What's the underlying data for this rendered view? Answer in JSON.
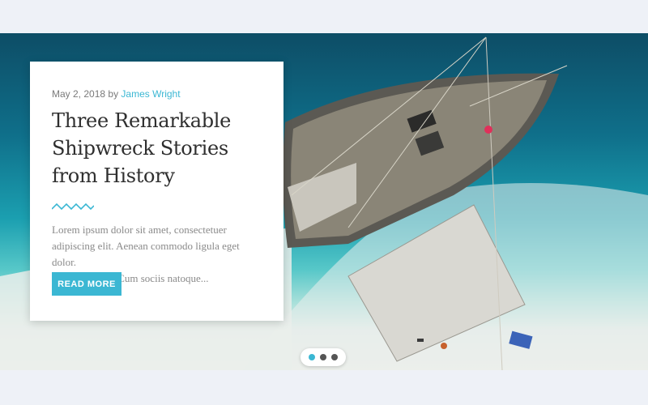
{
  "post": {
    "date": "May 2, 2018",
    "by": "by",
    "author": "James Wright",
    "title_line1": "Three Remarkable",
    "title_line2": "Shipwreck Stories",
    "title_line3": "from History",
    "excerpt_line1": "Lorem ipsum dolor sit amet, consectetuer",
    "excerpt_line2": "adipiscing elit. Aenean commodo ligula eget dolor.",
    "excerpt_line3": "Aenean massa. Cum sociis natoque...",
    "button_label": "READ MORE"
  },
  "slider": {
    "active_index": 0,
    "dot_count": 3
  },
  "colors": {
    "accent": "#3bb7d3",
    "title": "#2f2f2f",
    "text": "#8a8a8a"
  }
}
